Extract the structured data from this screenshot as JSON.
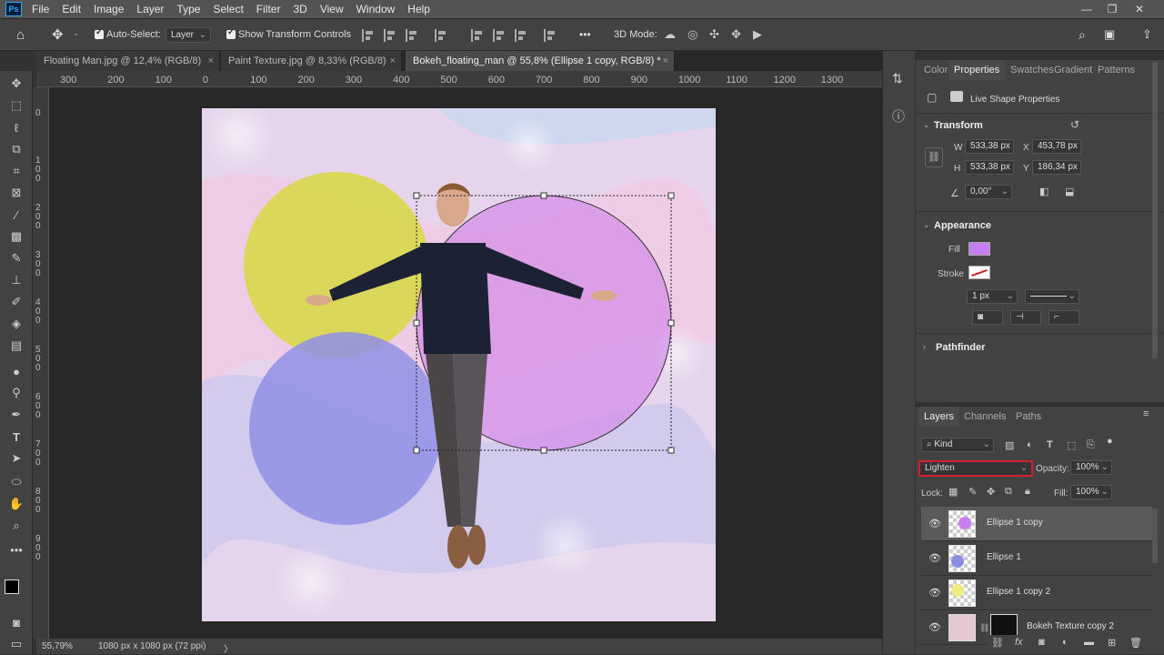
{
  "menu": {
    "logo": "Ps",
    "items": [
      "File",
      "Edit",
      "Image",
      "Layer",
      "Type",
      "Select",
      "Filter",
      "3D",
      "View",
      "Window",
      "Help"
    ]
  },
  "options": {
    "auto_select_label": "Auto-Select:",
    "auto_select_value": "Layer",
    "transform_controls_label": "Show Transform Controls",
    "more": "•••",
    "mode3d_label": "3D Mode:"
  },
  "tabs": [
    {
      "label": "Floating Man.jpg @ 12,4% (RGB/8)",
      "close": "×"
    },
    {
      "label": "Paint Texture.jpg @ 8,33% (RGB/8)",
      "close": "×"
    },
    {
      "label": "Bokeh_floating_man @ 55,8% (Ellipse 1 copy, RGB/8) *",
      "close": "×"
    }
  ],
  "ruler_top": [
    "300",
    "200",
    "100",
    "0",
    "100",
    "200",
    "300",
    "400",
    "500",
    "600",
    "700",
    "800",
    "900",
    "1000",
    "1100",
    "1200",
    "1300"
  ],
  "ruler_left": [
    "0",
    "1 0 0",
    "2 0 0",
    "3 0 0",
    "4 0 0",
    "5 0 0",
    "6 0 0",
    "7 0 0",
    "8 0 0",
    "9 0 0"
  ],
  "status": {
    "zoom": "55,79%",
    "doc_info": "1080 px x 1080 px (72 ppi)",
    "arrow": "〉"
  },
  "properties": {
    "tabs": [
      "Color",
      "Properties",
      "Swatches",
      "Gradient",
      "Patterns"
    ],
    "active_tab": "Properties",
    "live_shape_label": "Live Shape Properties",
    "transform_title": "Transform",
    "w_label": "W",
    "w_value": "533,38 px",
    "x_label": "X",
    "x_value": "453,78 px",
    "h_label": "H",
    "h_value": "533,38 px",
    "y_label": "Y",
    "y_value": "186,34 px",
    "angle_value": "0,00°",
    "appearance_title": "Appearance",
    "fill_label": "Fill",
    "fill_color": "#c77ff0",
    "stroke_label": "Stroke",
    "stroke_width": "1 px",
    "pathfinder_title": "Pathfinder"
  },
  "layers": {
    "tabs": [
      "Layers",
      "Channels",
      "Paths"
    ],
    "active_tab": "Layers",
    "kind_label": "Kind",
    "blend_mode": "Lighten",
    "opacity_label": "Opacity:",
    "opacity_value": "100%",
    "lock_label": "Lock:",
    "fill_label": "Fill:",
    "fill_value": "100%",
    "items": [
      {
        "name": "Ellipse 1 copy",
        "swatch": "#c77ff0",
        "selected": true
      },
      {
        "name": "Ellipse 1",
        "swatch": "#8a8ee0",
        "selected": false
      },
      {
        "name": "Ellipse 1 copy 2",
        "swatch": "#f0ec80",
        "selected": false
      },
      {
        "name": "Bokeh Texture copy 2",
        "swatch": "#e6c8d0",
        "selected": false
      }
    ]
  },
  "colors": {
    "highlight": "#d0202a",
    "yellow_circle": "#d8d84a",
    "blue_circle": "#8f90e6",
    "pink_circle": "#d48ae8"
  }
}
